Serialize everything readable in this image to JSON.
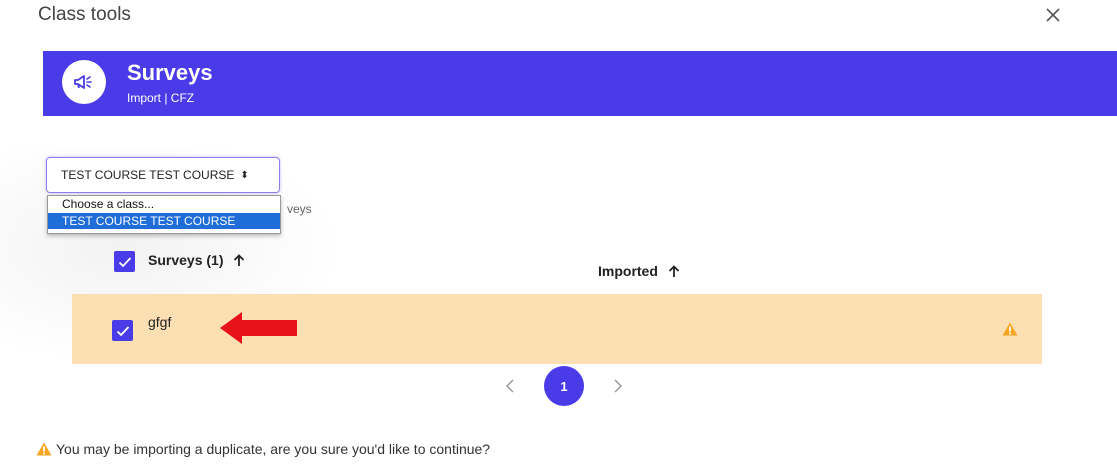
{
  "dialog": {
    "title": "Class tools"
  },
  "banner": {
    "title": "Surveys",
    "subtitle": "Import | CFZ"
  },
  "class_select": {
    "value": "TEST COURSE TEST COURSE",
    "options": [
      "Choose a class...",
      "TEST COURSE TEST COURSE"
    ],
    "partial_text": "veys"
  },
  "table": {
    "columns": [
      {
        "label": "Surveys (1)",
        "sort": "asc"
      },
      {
        "label": "Imported",
        "sort": "asc"
      }
    ],
    "rows": [
      {
        "name": "gfgf",
        "checked": true,
        "warning": true
      }
    ]
  },
  "pagination": {
    "current": "1"
  },
  "footer": {
    "warning": "You may be importing a duplicate, are you sure you'd like to continue?"
  },
  "colors": {
    "accent": "#4a3be8",
    "row_warning_bg": "#fce0b4",
    "warning": "#f5a623",
    "annotation_arrow": "#e8131a"
  },
  "icons": {
    "banner": "megaphone-icon",
    "close": "close-icon",
    "warning": "warning-triangle-icon"
  }
}
